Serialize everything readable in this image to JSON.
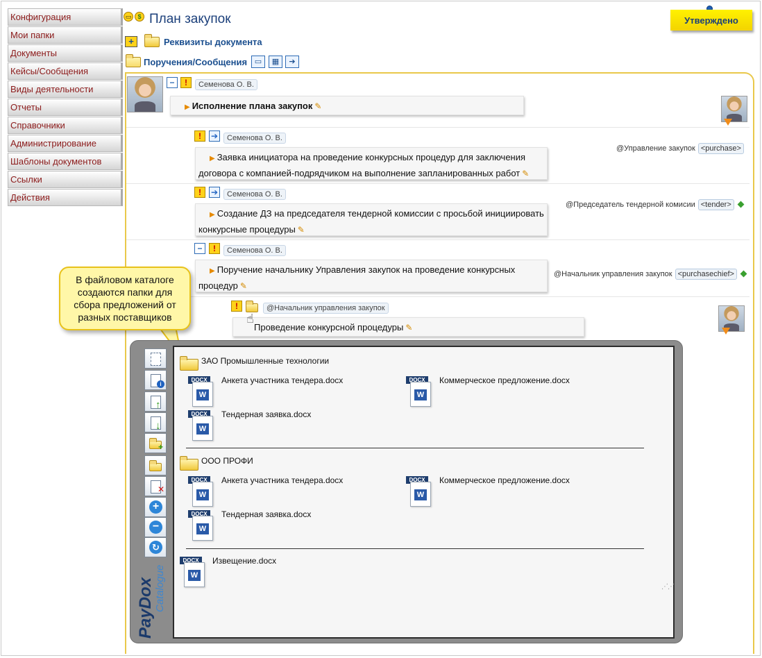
{
  "sidebar": {
    "items": [
      {
        "label": "Конфигурация"
      },
      {
        "label": "Мои папки"
      },
      {
        "label": "Документы"
      },
      {
        "label": "Кейсы/Сообщения"
      },
      {
        "label": "Виды деятельности"
      },
      {
        "label": "Отчеты"
      },
      {
        "label": "Справочники"
      },
      {
        "label": "Администрирование"
      },
      {
        "label": "Шаблоны документов"
      },
      {
        "label": "Ссылки"
      },
      {
        "label": "Действия"
      }
    ]
  },
  "header": {
    "title": "План закупок",
    "status": "Утверждено",
    "requisites_label": "Реквизиты документа",
    "tasks_label": "Поручения/Сообщения"
  },
  "thread": {
    "root": {
      "author": "Семенова О. В.",
      "text": "Исполнение плана закупок"
    },
    "tasks": [
      {
        "author": "Семенова О. В.",
        "text_line1": "Заявка инициатора на проведение конкурсных процедур для заключения",
        "text_line2": "договора с компанией-подрядчиком на выполнение запланированных работ",
        "assignee": "@Управление закупок",
        "code": "<purchase>"
      },
      {
        "author": "Семенова О. В.",
        "text_line1": "Создание ДЗ на председателя тендерной комиссии с просьбой инициировать",
        "text_line2": "конкурсные процедуры",
        "assignee": "@Председатель тендерной комисии",
        "code": "<tender>"
      },
      {
        "author": "Семенова О. В.",
        "text_line1": "Поручение начальнику Управления закупок на проведение конкурсных",
        "text_line2": "процедур",
        "assignee": "@Начальник управления закупок",
        "code": "<purchasechief>"
      }
    ],
    "subtask": {
      "author": "@Начальник управления закупок",
      "text": "Проведение конкурсной процедуры"
    }
  },
  "callout": {
    "line1": "В файловом каталоге",
    "line2": "создаются папки для",
    "line3": "сбора предложений от",
    "line4": "разных поставщиков"
  },
  "catalogue": {
    "brand": "PayDox",
    "brand_sub": "Catalogue",
    "file_tag": "DOCX",
    "folders": [
      {
        "name": "ЗАО Промышленные технологии",
        "files": [
          "Анкета участника тендера.docx",
          "Коммерческое предложение.docx",
          "Тендерная заявка.docx"
        ]
      },
      {
        "name": "ООО ПРОФИ",
        "files": [
          "Анкета участника тендера.docx",
          "Коммерческое предложение.docx",
          "Тендерная заявка.docx"
        ]
      }
    ],
    "root_files": [
      "Извещение.docx"
    ]
  },
  "colors": {
    "nav_text": "#8b1a1a",
    "title_blue": "#1b3f7a",
    "status_yellow": "#fff200",
    "panel_border": "#e9c84a"
  }
}
